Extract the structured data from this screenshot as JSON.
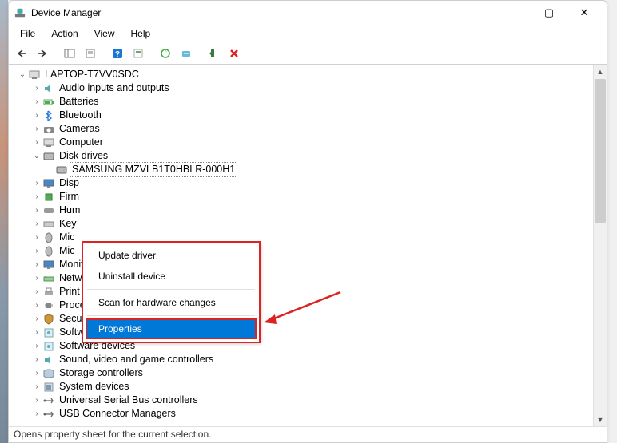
{
  "window": {
    "title": "Device Manager"
  },
  "menus": [
    "File",
    "Action",
    "View",
    "Help"
  ],
  "tree": {
    "root": "LAPTOP-T7VV0SDC",
    "items": [
      {
        "label": "Audio inputs and outputs"
      },
      {
        "label": "Batteries"
      },
      {
        "label": "Bluetooth"
      },
      {
        "label": "Cameras"
      },
      {
        "label": "Computer"
      },
      {
        "label": "Disk drives",
        "expanded": true,
        "child": "SAMSUNG MZVLB1T0HBLR-000H1"
      },
      {
        "label": "Disp"
      },
      {
        "label": "Firm"
      },
      {
        "label": "Hum"
      },
      {
        "label": "Key"
      },
      {
        "label": "Mic"
      },
      {
        "label": "Mic"
      },
      {
        "label": "Monitors"
      },
      {
        "label": "Network adapters"
      },
      {
        "label": "Print queues"
      },
      {
        "label": "Processors"
      },
      {
        "label": "Security devices"
      },
      {
        "label": "Software components"
      },
      {
        "label": "Software devices"
      },
      {
        "label": "Sound, video and game controllers"
      },
      {
        "label": "Storage controllers"
      },
      {
        "label": "System devices"
      },
      {
        "label": "Universal Serial Bus controllers"
      },
      {
        "label": "USB Connector Managers"
      }
    ]
  },
  "context": {
    "update": "Update driver",
    "uninstall": "Uninstall device",
    "scan": "Scan for hardware changes",
    "properties": "Properties"
  },
  "status": "Opens property sheet for the current selection."
}
